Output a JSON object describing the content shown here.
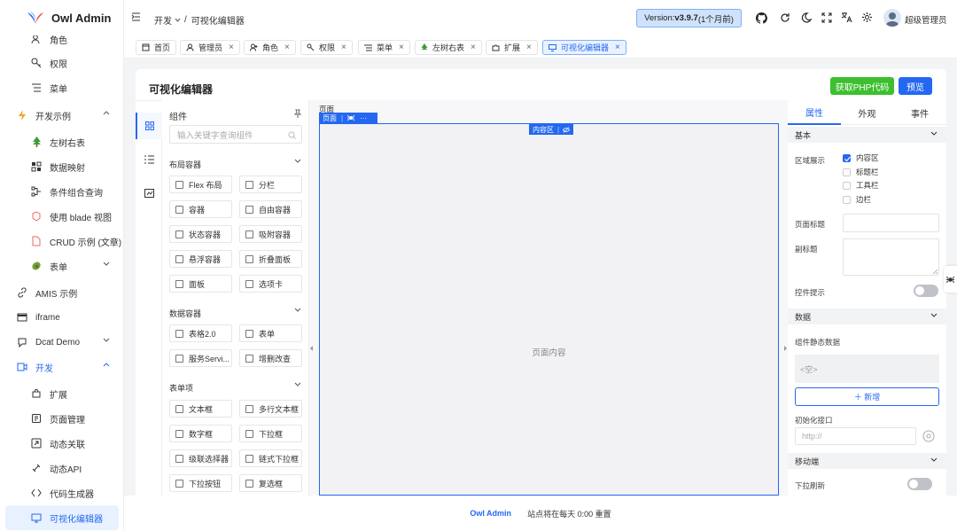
{
  "app": {
    "name": "Owl Admin"
  },
  "sidebar": {
    "items": [
      {
        "label": "角色",
        "icon": "user-group-icon"
      },
      {
        "label": "权限",
        "icon": "key-icon"
      },
      {
        "label": "菜单",
        "icon": "menu-list-icon"
      },
      {
        "label": "开发示例",
        "icon": "bolt-icon"
      },
      {
        "label": "左树右表",
        "icon": "tree-icon"
      },
      {
        "label": "数据映射",
        "icon": "mapping-icon"
      },
      {
        "label": "条件组合查询",
        "icon": "query-icon"
      },
      {
        "label": "使用 blade 视图",
        "icon": "blade-icon"
      },
      {
        "label": "CRUD 示例 (文章)",
        "icon": "file-icon"
      },
      {
        "label": "表单",
        "icon": "avocado-icon"
      },
      {
        "label": "AMIS 示例",
        "icon": "link-icon"
      },
      {
        "label": "iframe",
        "icon": "iframe-icon"
      },
      {
        "label": "Dcat Demo",
        "icon": "dcat-icon"
      },
      {
        "label": "开发",
        "icon": "dev-icon"
      },
      {
        "label": "扩展",
        "icon": "extension-icon"
      },
      {
        "label": "页面管理",
        "icon": "page-icon"
      },
      {
        "label": "动态关联",
        "icon": "relation-icon"
      },
      {
        "label": "动态API",
        "icon": "api-icon"
      },
      {
        "label": "代码生成器",
        "icon": "code-icon"
      },
      {
        "label": "可视化编辑器",
        "icon": "monitor-icon"
      }
    ]
  },
  "header": {
    "breadcrumb_parent": "开发",
    "breadcrumb_sep": "/",
    "breadcrumb_current": "可视化编辑器",
    "version_label": "Version: ",
    "version_value": "v3.9.7",
    "version_note": " (1个月前)",
    "user_name": "超级管理员"
  },
  "tabs": [
    {
      "label": "首页",
      "closable": false
    },
    {
      "label": "管理员",
      "closable": true
    },
    {
      "label": "角色",
      "closable": true
    },
    {
      "label": "权限",
      "closable": true
    },
    {
      "label": "菜单",
      "closable": true
    },
    {
      "label": "左树右表",
      "closable": true
    },
    {
      "label": "扩展",
      "closable": true
    },
    {
      "label": "可视化编辑器",
      "closable": true,
      "active": true
    }
  ],
  "page": {
    "title": "可视化编辑器",
    "btn_php": "获取PHP代码",
    "btn_preview": "预览"
  },
  "components": {
    "title": "组件",
    "search_placeholder": "输入关键字查询组件",
    "groups": [
      {
        "label": "布局容器",
        "items": [
          "Flex 布局",
          "分栏",
          "容器",
          "自由容器",
          "状态容器",
          "吸附容器",
          "悬浮容器",
          "折叠面板",
          "面板",
          "选项卡"
        ]
      },
      {
        "label": "数据容器",
        "items": [
          "表格2.0",
          "表单",
          "服务Servi...",
          "增删改查"
        ]
      },
      {
        "label": "表单项",
        "items": [
          "文本框",
          "多行文本框",
          "数字框",
          "下拉框",
          "级联选择器",
          "链式下拉框",
          "下拉按钮",
          "复选框"
        ]
      }
    ]
  },
  "canvas": {
    "page_label": "页面",
    "toolbar_label": "页面",
    "toolbar_more": "···",
    "body_tag": "内容区",
    "placeholder": "页面内容"
  },
  "props": {
    "tabs": [
      "属性",
      "外观",
      "事件"
    ],
    "sec_basic": "基本",
    "region_label": "区域展示",
    "regions": [
      {
        "label": "内容区",
        "checked": true
      },
      {
        "label": "标题栏",
        "checked": false
      },
      {
        "label": "工具栏",
        "checked": false
      },
      {
        "label": "边栏",
        "checked": false
      }
    ],
    "page_title_label": "页面标题",
    "subtitle_label": "副标题",
    "tooltip_label": "控件提示",
    "sec_data": "数据",
    "static_data_label": "组件静态数据",
    "empty_label": "<空>",
    "add_label": "＋ 新增",
    "init_api_label": "初始化接口",
    "init_api_placeholder": "http://",
    "sec_mobile": "移动端",
    "pull_refresh_label": "下拉刷新"
  },
  "footer": {
    "brand": "Owl Admin",
    "notice": "站点将在每天 0:00 重置"
  },
  "colors": {
    "primary": "#2468f2",
    "success": "#3dbf2f"
  }
}
